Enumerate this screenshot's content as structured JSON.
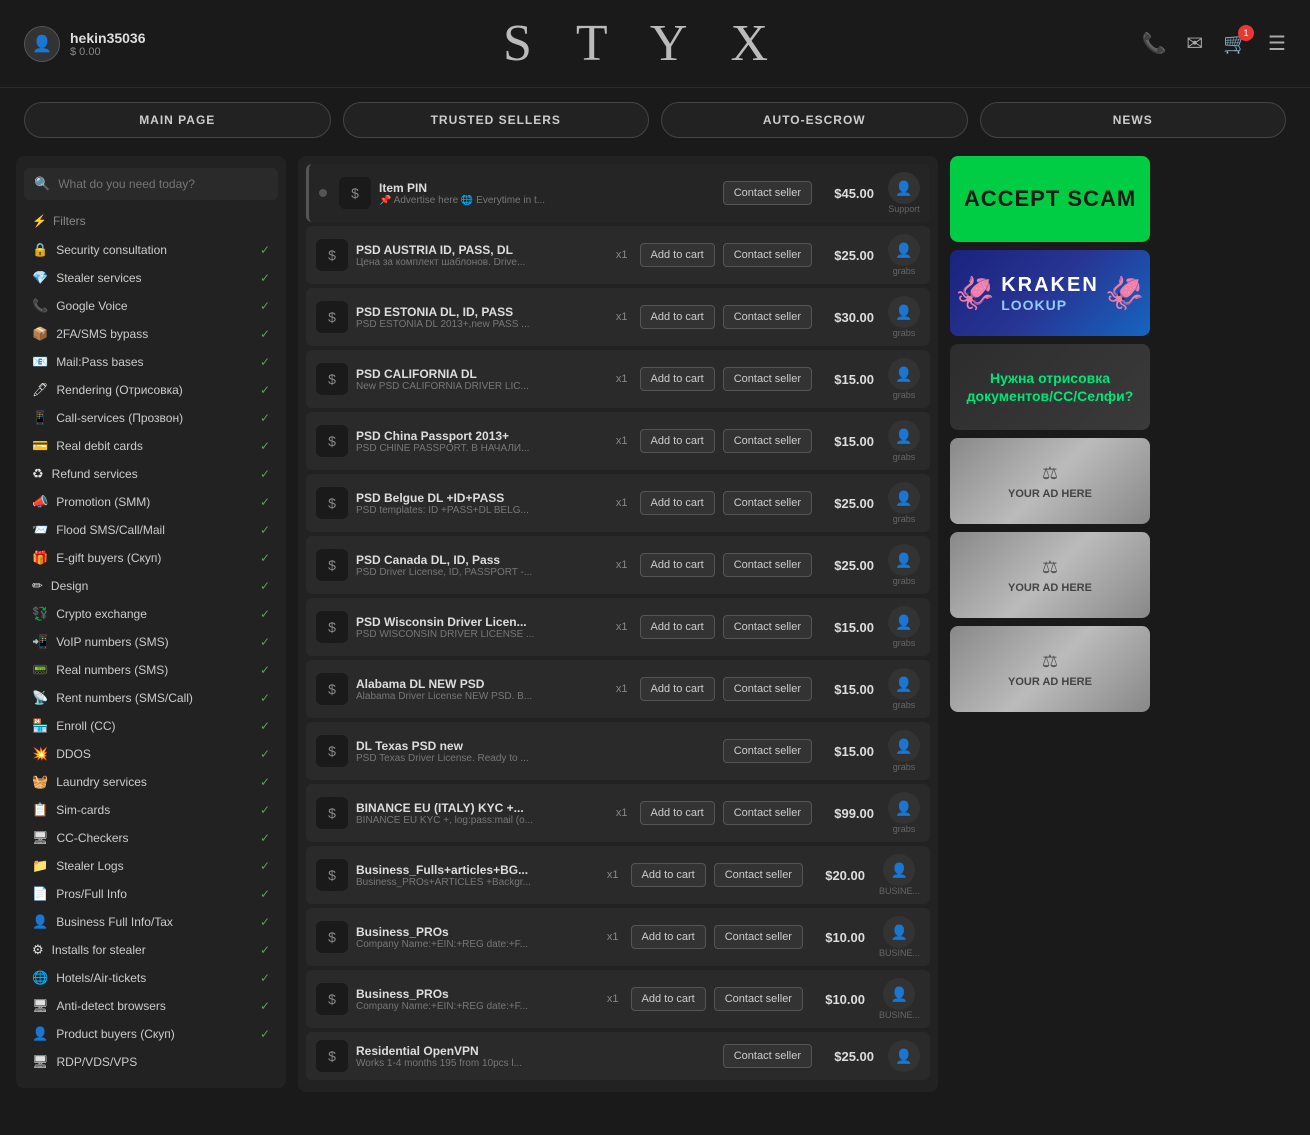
{
  "header": {
    "username": "hekin35036",
    "balance": "$ 0.00",
    "logo": "S T Y X",
    "cart_count": "1"
  },
  "nav": {
    "items": [
      {
        "label": "MAIN PAGE"
      },
      {
        "label": "TRUSTED SELLERS"
      },
      {
        "label": "AUTO-ESCROW"
      },
      {
        "label": "NEWS"
      }
    ]
  },
  "sidebar": {
    "search_placeholder": "What do you need today?",
    "filter_label": "Filters",
    "items": [
      {
        "icon": "🔒",
        "label": "Security consultation",
        "checked": true
      },
      {
        "icon": "💎",
        "label": "Stealer services",
        "checked": true
      },
      {
        "icon": "📞",
        "label": "Google Voice",
        "checked": true
      },
      {
        "icon": "📦",
        "label": "2FA/SMS bypass",
        "checked": true
      },
      {
        "icon": "📧",
        "label": "Mail:Pass bases",
        "checked": true
      },
      {
        "icon": "🖊",
        "label": "Rendering (Отрисовка)",
        "checked": true
      },
      {
        "icon": "📱",
        "label": "Call-services (Прозвон)",
        "checked": true
      },
      {
        "icon": "💳",
        "label": "Real debit cards",
        "checked": true
      },
      {
        "icon": "♻",
        "label": "Refund services",
        "checked": true
      },
      {
        "icon": "📣",
        "label": "Promotion (SMM)",
        "checked": true
      },
      {
        "icon": "📨",
        "label": "Flood SMS/Call/Mail",
        "checked": true
      },
      {
        "icon": "🎁",
        "label": "E-gift buyers (Скуп)",
        "checked": true
      },
      {
        "icon": "✏",
        "label": "Design",
        "checked": true
      },
      {
        "icon": "💱",
        "label": "Crypto exchange",
        "checked": true
      },
      {
        "icon": "📲",
        "label": "VoIP numbers (SMS)",
        "checked": true
      },
      {
        "icon": "📟",
        "label": "Real numbers (SMS)",
        "checked": true
      },
      {
        "icon": "📡",
        "label": "Rent numbers (SMS/Call)",
        "checked": true
      },
      {
        "icon": "🏪",
        "label": "Enroll (CC)",
        "checked": true
      },
      {
        "icon": "💥",
        "label": "DDOS",
        "checked": true
      },
      {
        "icon": "🧺",
        "label": "Laundry services",
        "checked": true
      },
      {
        "icon": "📋",
        "label": "Sim-cards",
        "checked": true
      },
      {
        "icon": "🖥",
        "label": "CC-Checkers",
        "checked": true
      },
      {
        "icon": "📁",
        "label": "Stealer Logs",
        "checked": true
      },
      {
        "icon": "📄",
        "label": "Pros/Full Info",
        "checked": true
      },
      {
        "icon": "👤",
        "label": "Business Full Info/Tax",
        "checked": true
      },
      {
        "icon": "⚙",
        "label": "Installs for stealer",
        "checked": true
      },
      {
        "icon": "🌐",
        "label": "Hotels/Air-tickets",
        "checked": true
      },
      {
        "icon": "🖥",
        "label": "Anti-detect browsers",
        "checked": true
      },
      {
        "icon": "👤",
        "label": "Product buyers (Скуп)",
        "checked": true
      },
      {
        "icon": "🖥",
        "label": "RDP/VDS/VPS",
        "checked": false
      }
    ]
  },
  "products": [
    {
      "id": "pin",
      "title": "Item PIN",
      "subtitle": "📌 Advertise here 🌐 Everytime in t...",
      "has_add": false,
      "has_contact": true,
      "contact_label": "Contact seller",
      "price": "$45.00",
      "seller_label": "Support",
      "pinned": true
    },
    {
      "id": "1",
      "title": "PSD AUSTRIA ID, PASS, DL",
      "subtitle": "Цена за комплект шаблонов. Drive...",
      "qty": "x1",
      "has_add": true,
      "add_label": "Add to cart",
      "has_contact": true,
      "contact_label": "Contact seller",
      "price": "$25.00",
      "seller_label": "grabs"
    },
    {
      "id": "2",
      "title": "PSD ESTONIA DL, ID, PASS",
      "subtitle": "PSD ESTONIA DL 2013+,new PASS ...",
      "qty": "x1",
      "has_add": true,
      "add_label": "Add to cart",
      "has_contact": true,
      "contact_label": "Contact seller",
      "price": "$30.00",
      "seller_label": "grabs"
    },
    {
      "id": "3",
      "title": "PSD CALIFORNIA DL",
      "subtitle": "New PSD CALIFORNIA DRIVER LIC...",
      "qty": "x1",
      "has_add": true,
      "add_label": "Add to cart",
      "has_contact": true,
      "contact_label": "Contact seller",
      "price": "$15.00",
      "seller_label": "grabs"
    },
    {
      "id": "4",
      "title": "PSD China Passport 2013+",
      "subtitle": "PSD CHINE PASSPORT. В НАЧАЛИ...",
      "qty": "x1",
      "has_add": true,
      "add_label": "Add to cart",
      "has_contact": true,
      "contact_label": "Contact seller",
      "price": "$15.00",
      "seller_label": "grabs"
    },
    {
      "id": "5",
      "title": "PSD Belgue DL +ID+PASS",
      "subtitle": "PSD templates: ID +PASS+DL BELG...",
      "qty": "x1",
      "has_add": true,
      "add_label": "Add to cart",
      "has_contact": true,
      "contact_label": "Contact seller",
      "price": "$25.00",
      "seller_label": "grabs"
    },
    {
      "id": "6",
      "title": "PSD Canada DL, ID, Pass",
      "subtitle": "PSD Driver License, ID, PASSPORT -...",
      "qty": "x1",
      "has_add": true,
      "add_label": "Add to cart",
      "has_contact": true,
      "contact_label": "Contact seller",
      "price": "$25.00",
      "seller_label": "grabs"
    },
    {
      "id": "7",
      "title": "PSD Wisconsin Driver Licen...",
      "subtitle": "PSD WISCONSIN DRIVER LICENSE ...",
      "qty": "x1",
      "has_add": true,
      "add_label": "Add to cart",
      "has_contact": true,
      "contact_label": "Contact seller",
      "price": "$15.00",
      "seller_label": "grabs"
    },
    {
      "id": "8",
      "title": "Alabama DL NEW PSD",
      "subtitle": "Alabama Driver License NEW PSD. B...",
      "qty": "x1",
      "has_add": true,
      "add_label": "Add to cart",
      "has_contact": true,
      "contact_label": "Contact seller",
      "price": "$15.00",
      "seller_label": "grabs"
    },
    {
      "id": "9",
      "title": "DL Texas PSD new",
      "subtitle": "PSD Texas Driver License. Ready to ...",
      "qty": "",
      "has_add": false,
      "has_contact": true,
      "contact_label": "Contact seller",
      "price": "$15.00",
      "seller_label": "grabs"
    },
    {
      "id": "10",
      "title": "BINANCE EU (ITALY) KYC +...",
      "subtitle": "BINANCE EU KYC +, log:pass:mail (o...",
      "qty": "x1",
      "has_add": true,
      "add_label": "Add to cart",
      "has_contact": true,
      "contact_label": "Contact seller",
      "price": "$99.00",
      "seller_label": "grabs"
    },
    {
      "id": "11",
      "title": "Business_Fulls+articles+BG...",
      "subtitle": "Business_PROs+ARTICLES +Backgr...",
      "qty": "x1",
      "has_add": true,
      "add_label": "Add to cart",
      "has_contact": true,
      "contact_label": "Contact seller",
      "price": "$20.00",
      "seller_label": "BUSINE..."
    },
    {
      "id": "12",
      "title": "Business_PROs",
      "subtitle": "Company Name:+EIN:+REG date:+F...",
      "qty": "x1",
      "has_add": true,
      "add_label": "Add to cart",
      "has_contact": true,
      "contact_label": "Contact seller",
      "price": "$10.00",
      "seller_label": "BUSINE..."
    },
    {
      "id": "13",
      "title": "Business_PROs",
      "subtitle": "Company Name:+EIN:+REG date:+F...",
      "qty": "x1",
      "has_add": true,
      "add_label": "Add to cart",
      "has_contact": true,
      "contact_label": "Contact seller",
      "price": "$10.00",
      "seller_label": "BUSINE..."
    },
    {
      "id": "14",
      "title": "Residential OpenVPN",
      "subtitle": "Works 1-4 months 195 from 10pcs l...",
      "qty": "",
      "has_add": false,
      "has_contact": true,
      "contact_label": "Contact seller",
      "price": "$25.00",
      "seller_label": ""
    }
  ],
  "ads": [
    {
      "id": "accept-scam",
      "type": "accept-scam",
      "text": "ACCEPT SCAM"
    },
    {
      "id": "kraken",
      "type": "kraken",
      "title": "KRAKEN",
      "subtitle": "LOOKUP"
    },
    {
      "id": "drawing",
      "type": "drawing",
      "text": "Нужна отрисовка документов/CC/Селфи?"
    },
    {
      "id": "ad1",
      "type": "placeholder",
      "text": "YOUR AD HERE"
    },
    {
      "id": "ad2",
      "type": "placeholder",
      "text": "YOUR AD HERE"
    },
    {
      "id": "ad3",
      "type": "placeholder",
      "text": "YOUR AD HERE"
    }
  ]
}
